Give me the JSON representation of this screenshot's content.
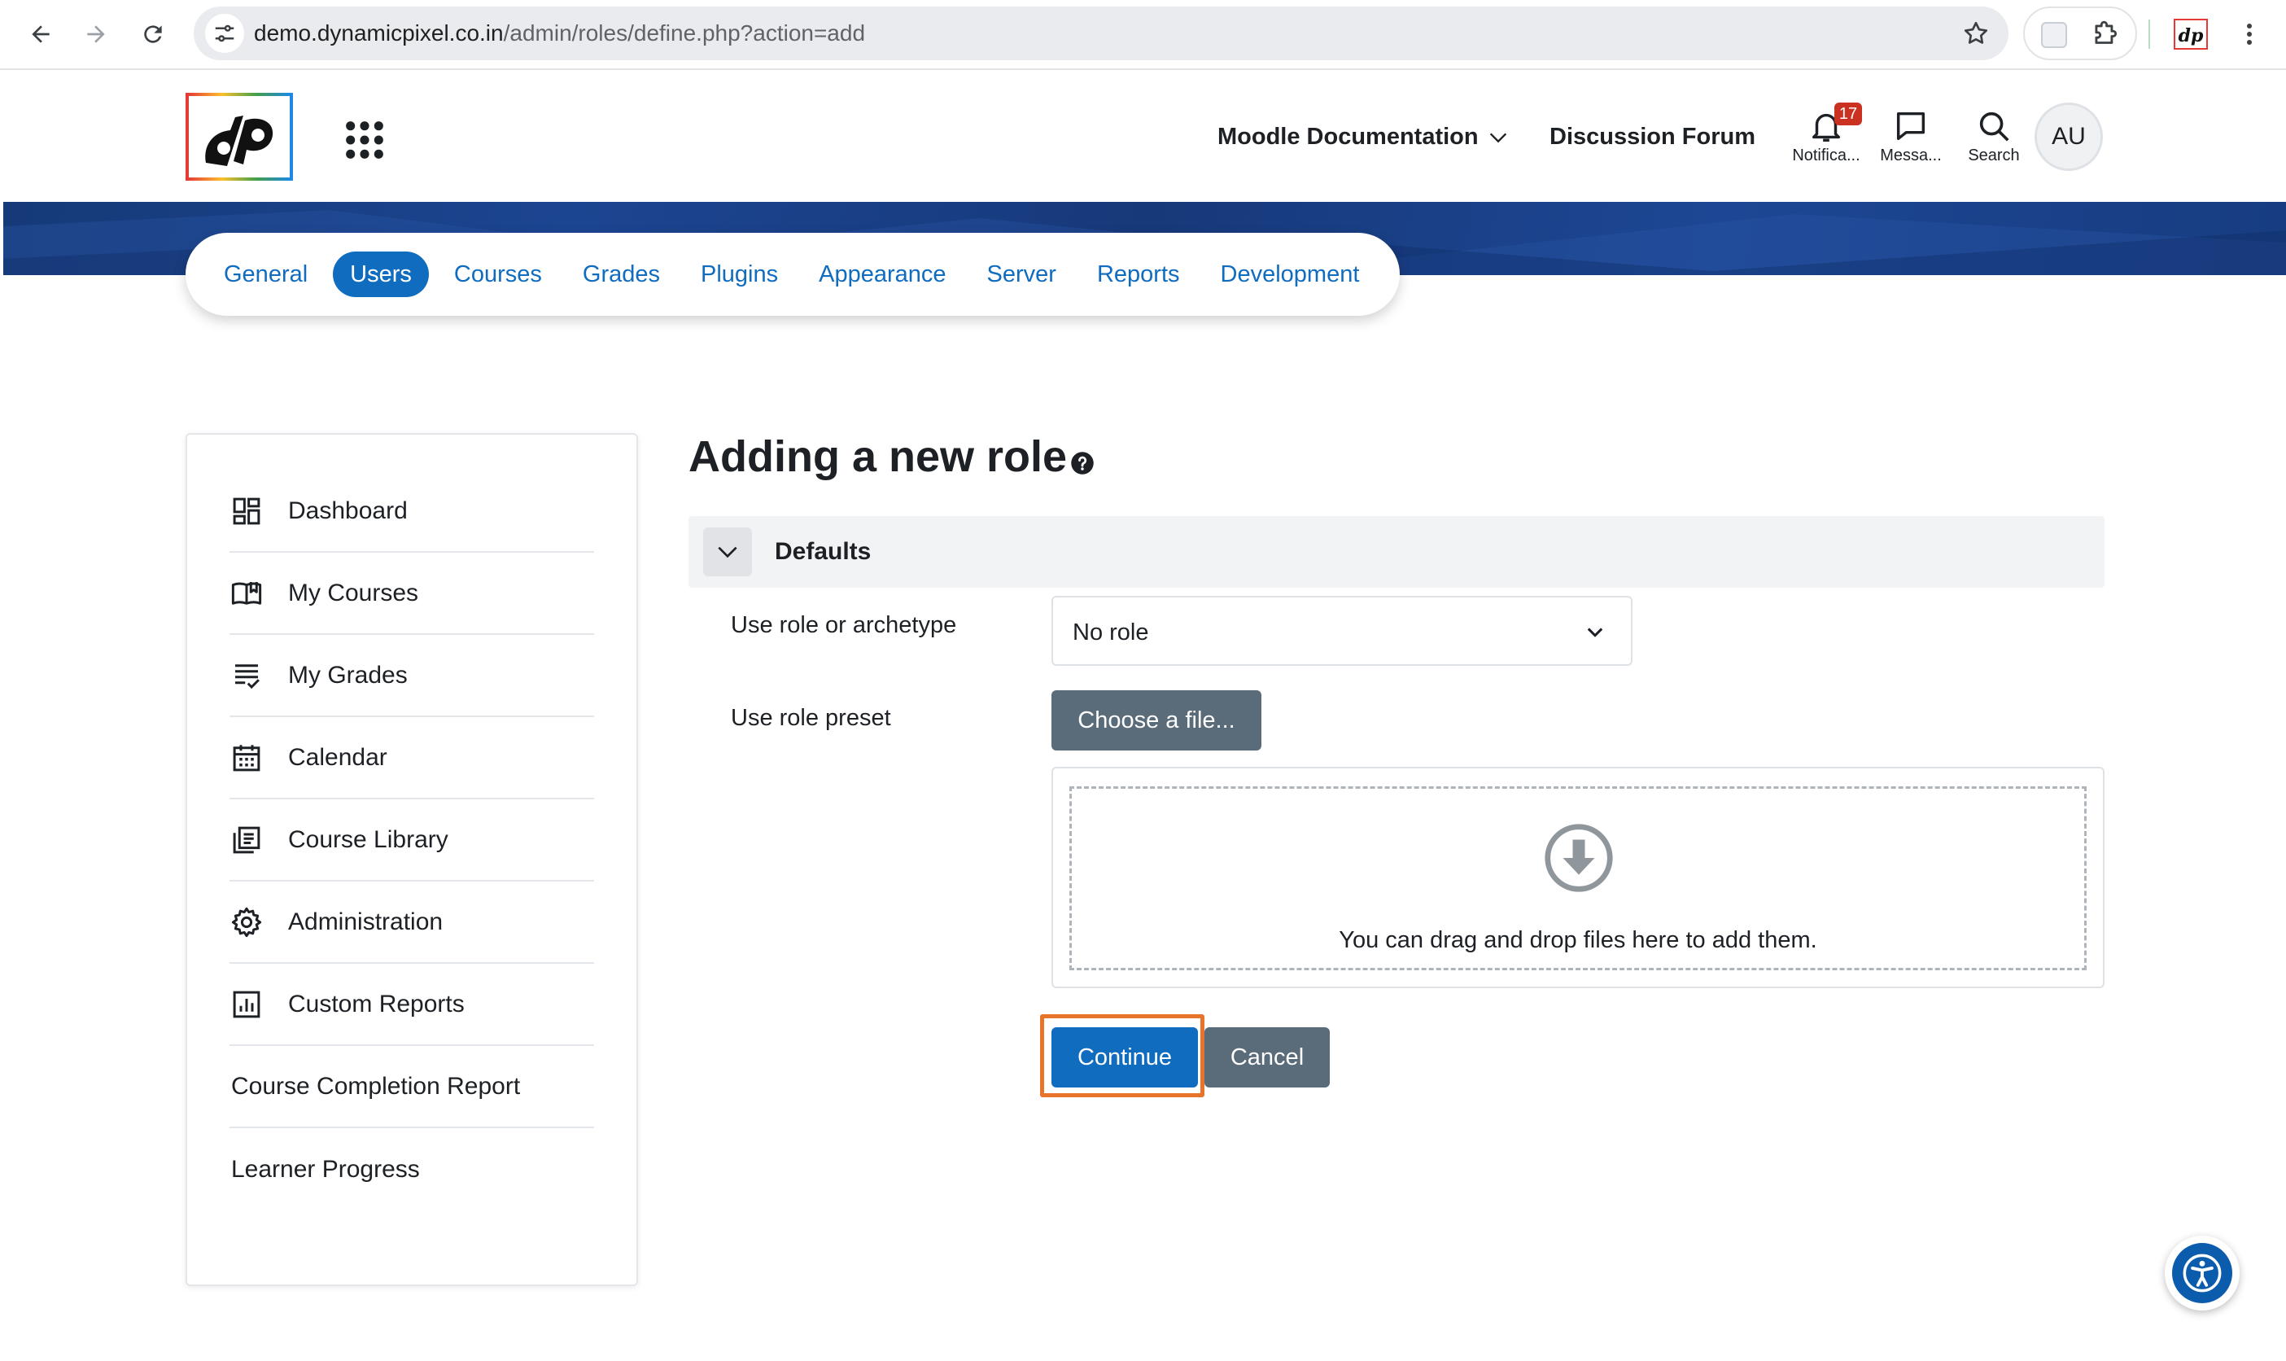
{
  "browser": {
    "url_host": "demo.dynamicpixel.co.in",
    "url_path": "/admin/roles/define.php?action=add"
  },
  "header": {
    "links": [
      {
        "label": "Moodle Documentation",
        "has_dropdown": true
      },
      {
        "label": "Discussion Forum",
        "has_dropdown": false
      }
    ],
    "notifications": {
      "caption": "Notifica...",
      "count": "17"
    },
    "messages": {
      "caption": "Messa..."
    },
    "search": {
      "caption": "Search"
    },
    "avatar_initials": "AU"
  },
  "admin_tabs": [
    {
      "label": "General",
      "active": false
    },
    {
      "label": "Users",
      "active": true
    },
    {
      "label": "Courses",
      "active": false
    },
    {
      "label": "Grades",
      "active": false
    },
    {
      "label": "Plugins",
      "active": false
    },
    {
      "label": "Appearance",
      "active": false
    },
    {
      "label": "Server",
      "active": false
    },
    {
      "label": "Reports",
      "active": false
    },
    {
      "label": "Development",
      "active": false
    }
  ],
  "sidebar": {
    "items": [
      {
        "label": "Dashboard",
        "icon": "dashboard-icon"
      },
      {
        "label": "My Courses",
        "icon": "book-icon"
      },
      {
        "label": "My Grades",
        "icon": "grades-icon"
      },
      {
        "label": "Calendar",
        "icon": "calendar-icon"
      },
      {
        "label": "Course Library",
        "icon": "library-icon"
      },
      {
        "label": "Administration",
        "icon": "gear-icon"
      },
      {
        "label": "Custom Reports",
        "icon": "report-chart-icon"
      },
      {
        "label": "Course Completion Report",
        "icon": ""
      },
      {
        "label": "Learner Progress",
        "icon": ""
      }
    ]
  },
  "main": {
    "title": "Adding a new role",
    "section": {
      "title": "Defaults",
      "expanded": true
    },
    "fields": {
      "archetype": {
        "label": "Use role or archetype",
        "value": "No role"
      },
      "preset": {
        "label": "Use role preset",
        "button": "Choose a file..."
      }
    },
    "dropzone_text": "You can drag and drop files here to add them.",
    "buttons": {
      "continue": "Continue",
      "cancel": "Cancel"
    }
  },
  "colors": {
    "primary": "#0f6cbf",
    "secondary": "#5a6b7a",
    "banner": "#1c4591",
    "focus_ring": "#e8742c",
    "badge": "#ca3120"
  }
}
